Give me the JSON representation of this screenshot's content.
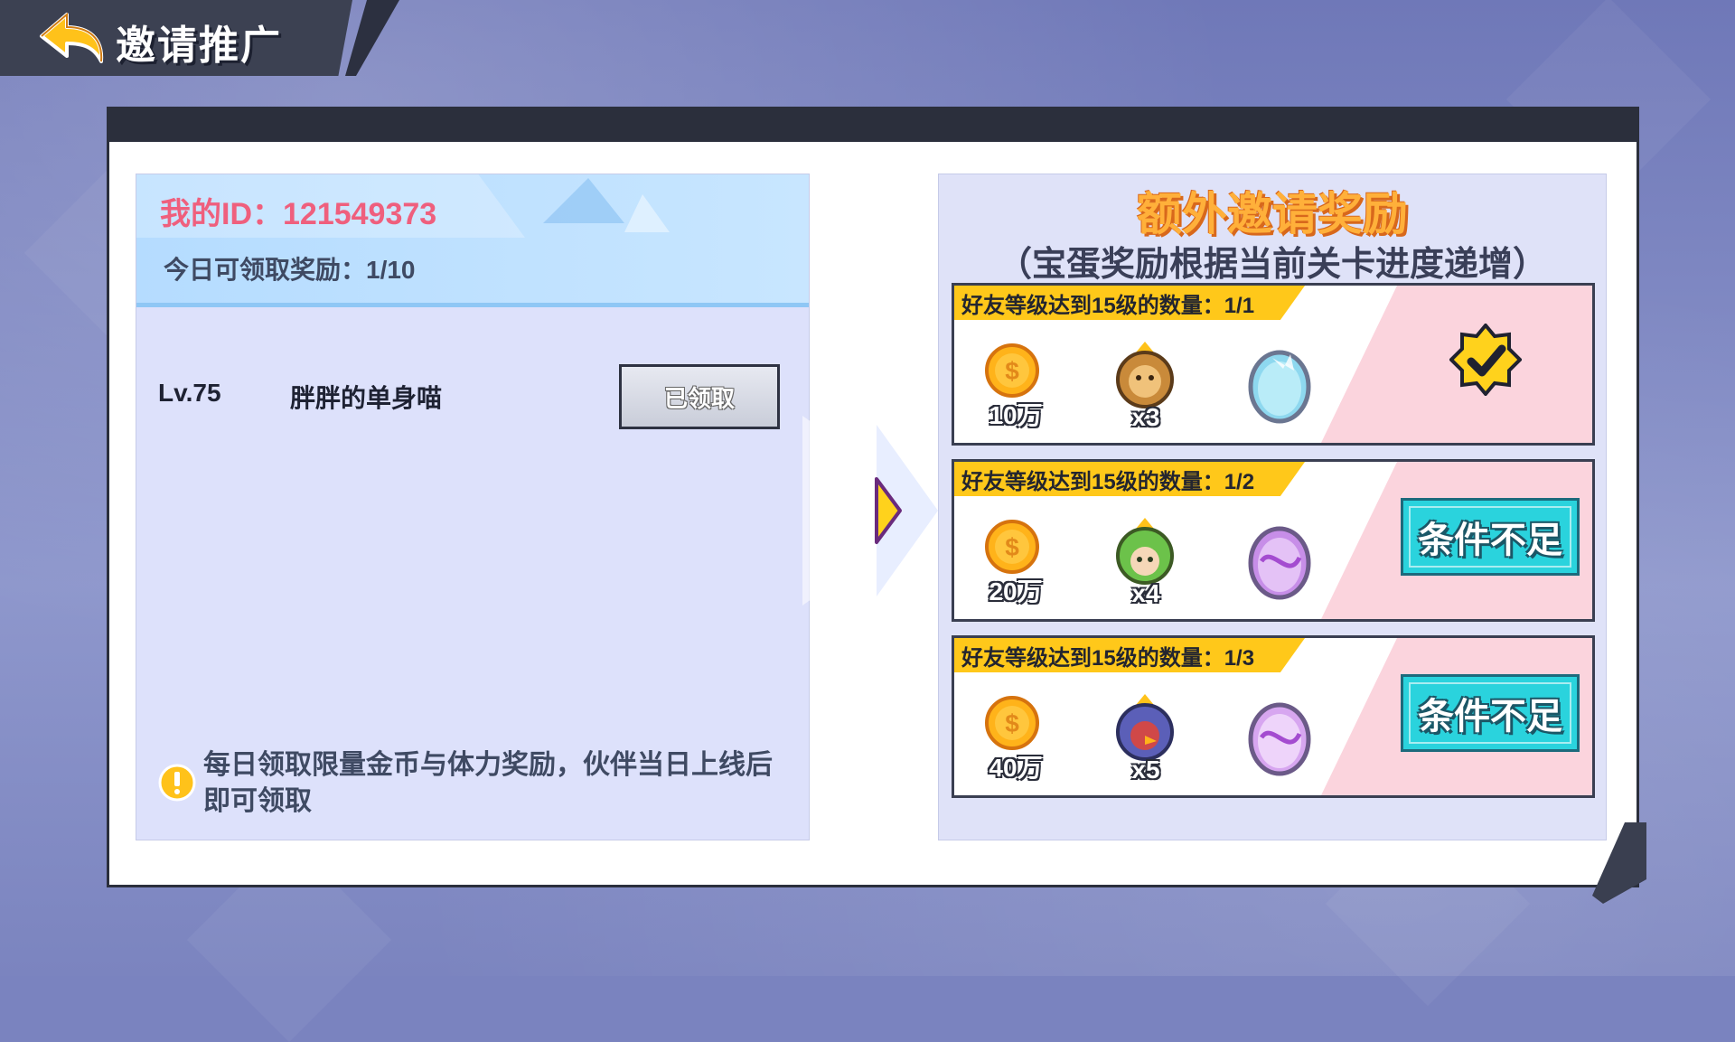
{
  "header": {
    "title": "邀请推广"
  },
  "invite": {
    "my_id_label": "我的ID：121549373",
    "daily_label": "今日可领取奖励：1/10"
  },
  "friends": [
    {
      "level": "Lv.75",
      "name": "胖胖的单身喵",
      "button": "已领取"
    }
  ],
  "tip": "每日领取限量金币与体力奖励，伙伴当日上线后即可领取",
  "extra": {
    "title": "额外邀请奖励",
    "subtitle": "（宝蛋奖励根据当前关卡进度递增）",
    "rewards": [
      {
        "condition": "好友等级达到15级的数量：1/1",
        "gold": "10万",
        "hero_count": "x3",
        "hero_icon": "lion-hero-icon",
        "egg_icon": "blue-egg-icon",
        "state": "done"
      },
      {
        "condition": "好友等级达到15级的数量：1/2",
        "gold": "20万",
        "hero_count": "x4",
        "hero_icon": "green-hair-hero-icon",
        "egg_icon": "purple-egg-icon",
        "button": "条件不足"
      },
      {
        "condition": "好友等级达到15级的数量：1/3",
        "gold": "40万",
        "hero_count": "x5",
        "hero_icon": "bird-hero-icon",
        "egg_icon": "purple-egg-icon",
        "button": "条件不足"
      }
    ]
  },
  "colors": {
    "accent_pink": "#ef5f7d",
    "title_orange": "#ffb03a",
    "button_cyan": "#2ad3dd",
    "banner_yellow": "#ffc81a"
  }
}
